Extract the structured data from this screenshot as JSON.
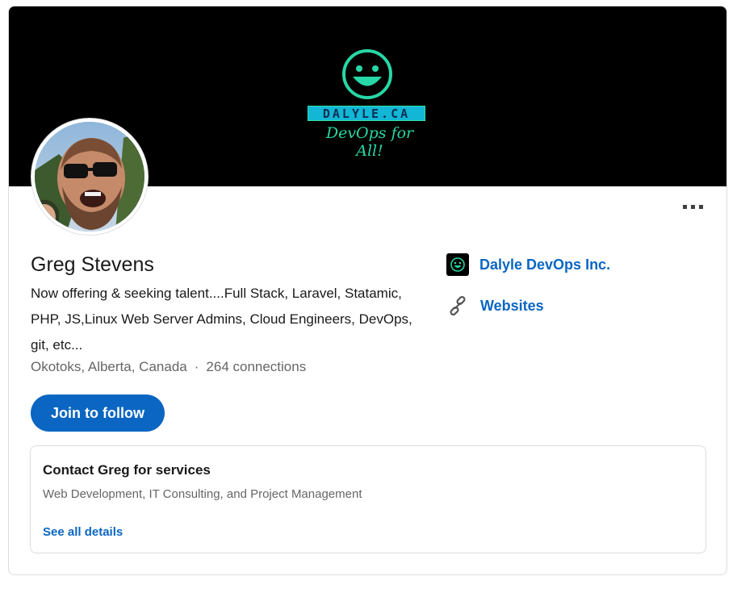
{
  "banner": {
    "logo_text": "DALYLE.CA",
    "logo_tagline": "DevOps for All!"
  },
  "profile": {
    "name": "Greg Stevens",
    "headline": "Now offering & seeking talent....Full Stack, Laravel, Statamic, PHP, JS,Linux Web Server Admins, Cloud Engineers, DevOps, git, etc...",
    "location": "Okotoks, Alberta, Canada",
    "separator": "·",
    "connections": "264 connections"
  },
  "right_column": {
    "company": "Dalyle DevOps Inc.",
    "websites": "Websites"
  },
  "actions": {
    "follow_label": "Join to follow",
    "more_icon": "ellipsis-icon"
  },
  "services": {
    "title": "Contact Greg for services",
    "description": "Web Development, IT Consulting, and Project Management",
    "link_label": "See all details"
  },
  "colors": {
    "accent": "#0a66c2",
    "banner_bg": "#000000",
    "logo_green": "#27d7a5",
    "logo_blue": "#12b7d6"
  }
}
